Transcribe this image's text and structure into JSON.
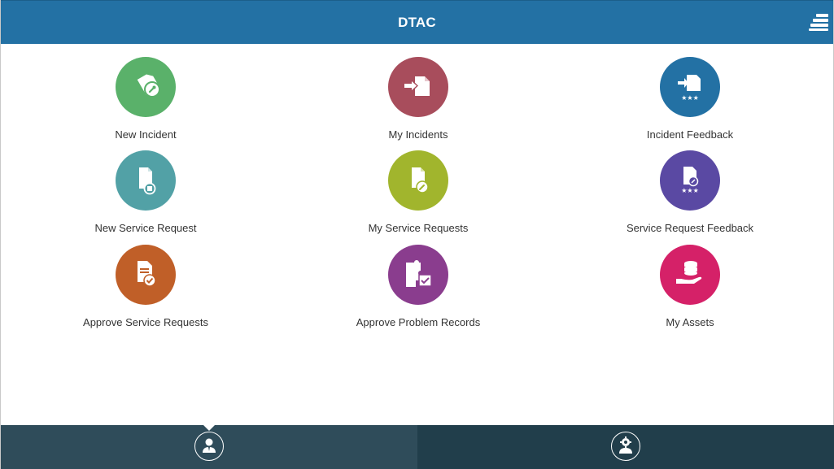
{
  "header": {
    "title": "DTAC",
    "menu_icon": "hamburger-menu-icon"
  },
  "tiles": [
    {
      "label": "New Incident",
      "icon": "ticket-wrench-icon",
      "color": "#5ab16a"
    },
    {
      "label": "My Incidents",
      "icon": "document-enter-icon",
      "color": "#a84d5c"
    },
    {
      "label": "Incident Feedback",
      "icon": "document-enter-stars-icon",
      "color": "#2371a4"
    },
    {
      "label": "New Service Request",
      "icon": "document-new-icon",
      "color": "#52a1a6"
    },
    {
      "label": "My Service Requests",
      "icon": "document-wrench-icon",
      "color": "#a1b52d"
    },
    {
      "label": "Service Request Feedback",
      "icon": "document-feedback-icon",
      "color": "#5a49a3"
    },
    {
      "label": "Approve Service Requests",
      "icon": "document-approve-icon",
      "color": "#c05f28"
    },
    {
      "label": "Approve Problem Records",
      "icon": "puzzle-approve-icon",
      "color": "#8a3d8e"
    },
    {
      "label": "My Assets",
      "icon": "hand-database-icon",
      "color": "#d52168"
    }
  ],
  "tabbar": {
    "tabs": [
      {
        "name": "user",
        "icon": "user-icon",
        "active": true
      },
      {
        "name": "admin",
        "icon": "user-gear-icon",
        "active": false
      }
    ]
  }
}
